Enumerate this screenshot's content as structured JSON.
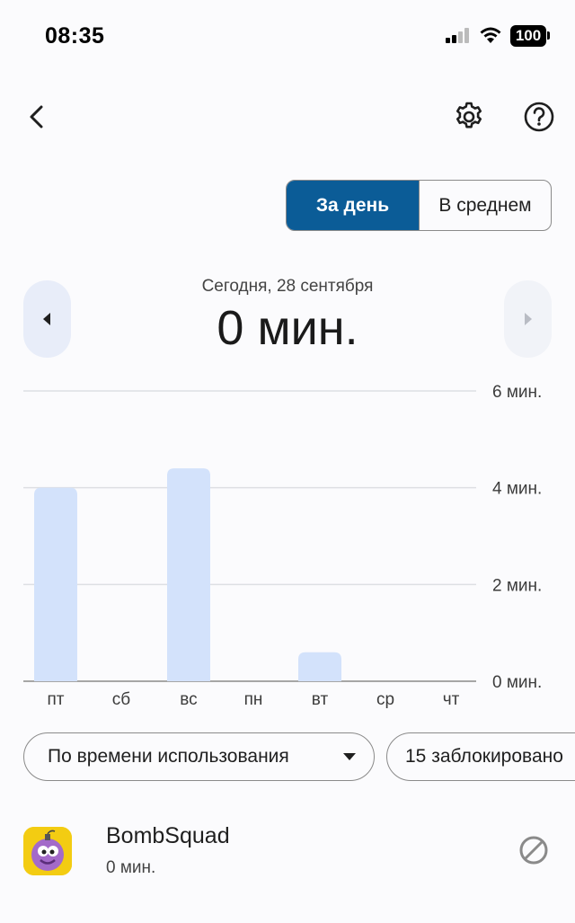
{
  "status_bar": {
    "time": "08:35",
    "battery": "100"
  },
  "icons": {
    "back": "arrow-back-icon",
    "settings": "gear-icon",
    "help": "help-circle-icon",
    "prev": "caret-left-icon",
    "next": "caret-right-icon",
    "dropdown": "caret-down-icon",
    "block": "block-icon"
  },
  "toggle": {
    "daily_label": "За день",
    "average_label": "В среднем",
    "active": "daily",
    "active_color": "#0b5c97"
  },
  "date": {
    "label": "Сегодня, 28 сентября",
    "total": "0 мин."
  },
  "chart_data": {
    "type": "bar",
    "categories": [
      "пт",
      "сб",
      "вс",
      "пн",
      "вт",
      "ср",
      "чт"
    ],
    "values": [
      4.0,
      0,
      4.4,
      0,
      0.6,
      0,
      0
    ],
    "ylim": [
      0,
      6
    ],
    "yticks": [
      0,
      2,
      4,
      6
    ],
    "ytick_labels": [
      "0 мин.",
      "2 мин.",
      "4 мин.",
      "6 мин."
    ],
    "bar_color": "#d3e2fb",
    "grid": true,
    "axis_side": "right"
  },
  "filters": {
    "sort_label": "По времени использования",
    "blocked_label": "15 заблокировано"
  },
  "apps": [
    {
      "name": "BombSquad",
      "time": "0 мин."
    }
  ]
}
